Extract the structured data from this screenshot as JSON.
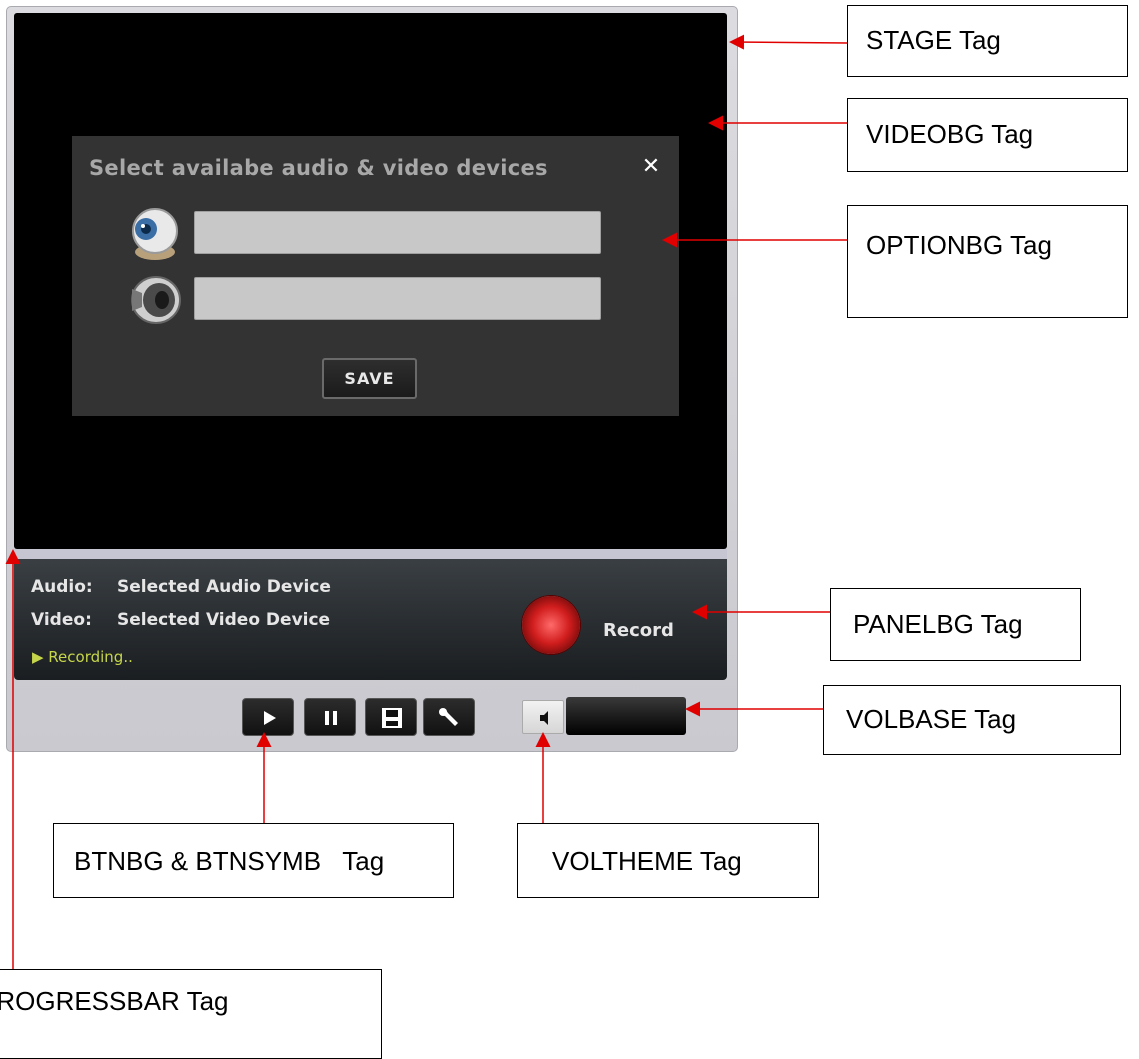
{
  "dialog": {
    "title": "Select availabe audio & video devices",
    "close": "✕",
    "save_label": "SAVE",
    "fields": [
      {
        "icon": "webcam-icon",
        "value": ""
      },
      {
        "icon": "speaker-icon",
        "value": ""
      }
    ]
  },
  "panel": {
    "audio_label": "Audio:",
    "audio_value": "Selected Audio Device",
    "video_label": "Video:",
    "video_value": "Selected Video Device",
    "status": "▶ Recording..",
    "record_label": "Record"
  },
  "controls": [
    "play-icon",
    "pause-icon",
    "save-disk-icon",
    "wrench-icon"
  ],
  "volume_icon": "speaker-small-icon",
  "callouts": {
    "stage": "STAGE Tag",
    "videobg": "VIDEOBG Tag",
    "optionbg": "OPTIONBG Tag",
    "panelbg": "PANELBG Tag",
    "volbase": "VOLBASE Tag",
    "btnbg": "BTNBG & BTNSYMB   Tag",
    "voltheme": "VOLTHEME Tag",
    "progressbar": "PROGRESSBAR Tag"
  },
  "colors": {
    "arrow": "#e00000",
    "status_text": "#c6d64a",
    "record_red": "#d11d1d"
  }
}
